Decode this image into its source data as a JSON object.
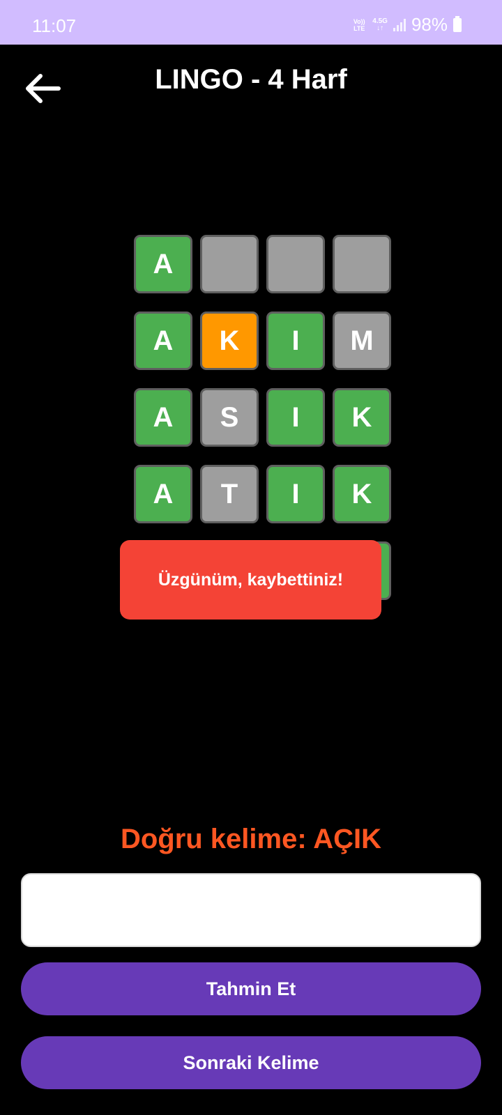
{
  "status_bar": {
    "time": "11:07",
    "net_top": "Vo)) LTE",
    "net_type": "4.5G",
    "battery": "98%"
  },
  "header": {
    "title": "LINGO - 4 Harf",
    "back_icon": "arrow-left-icon"
  },
  "board": {
    "rows": [
      [
        {
          "letter": "A",
          "state": "green"
        },
        {
          "letter": "",
          "state": "gray"
        },
        {
          "letter": "",
          "state": "gray"
        },
        {
          "letter": "",
          "state": "gray"
        }
      ],
      [
        {
          "letter": "A",
          "state": "green"
        },
        {
          "letter": "K",
          "state": "orange"
        },
        {
          "letter": "I",
          "state": "green"
        },
        {
          "letter": "M",
          "state": "gray"
        }
      ],
      [
        {
          "letter": "A",
          "state": "green"
        },
        {
          "letter": "S",
          "state": "gray"
        },
        {
          "letter": "I",
          "state": "green"
        },
        {
          "letter": "K",
          "state": "green"
        }
      ],
      [
        {
          "letter": "A",
          "state": "green"
        },
        {
          "letter": "T",
          "state": "gray"
        },
        {
          "letter": "I",
          "state": "green"
        },
        {
          "letter": "K",
          "state": "green"
        }
      ],
      [
        {
          "letter": "",
          "state": "green"
        },
        {
          "letter": "",
          "state": "green"
        },
        {
          "letter": "",
          "state": "green"
        },
        {
          "letter": "",
          "state": "green"
        }
      ]
    ]
  },
  "toast": {
    "message": "Üzgünüm, kaybettiniz!"
  },
  "result": {
    "correct_word_text": "Doğru kelime: AÇIK"
  },
  "input": {
    "value": "",
    "placeholder": ""
  },
  "buttons": {
    "guess_label": "Tahmin Et",
    "next_label": "Sonraki Kelime"
  },
  "colors": {
    "status_bar": "#d1bcff",
    "tile_green": "#4caf50",
    "tile_gray": "#9e9e9e",
    "tile_orange": "#ff9800",
    "toast_bg": "#f44336",
    "result_text": "#ff5722",
    "button_bg": "#673ab7"
  }
}
